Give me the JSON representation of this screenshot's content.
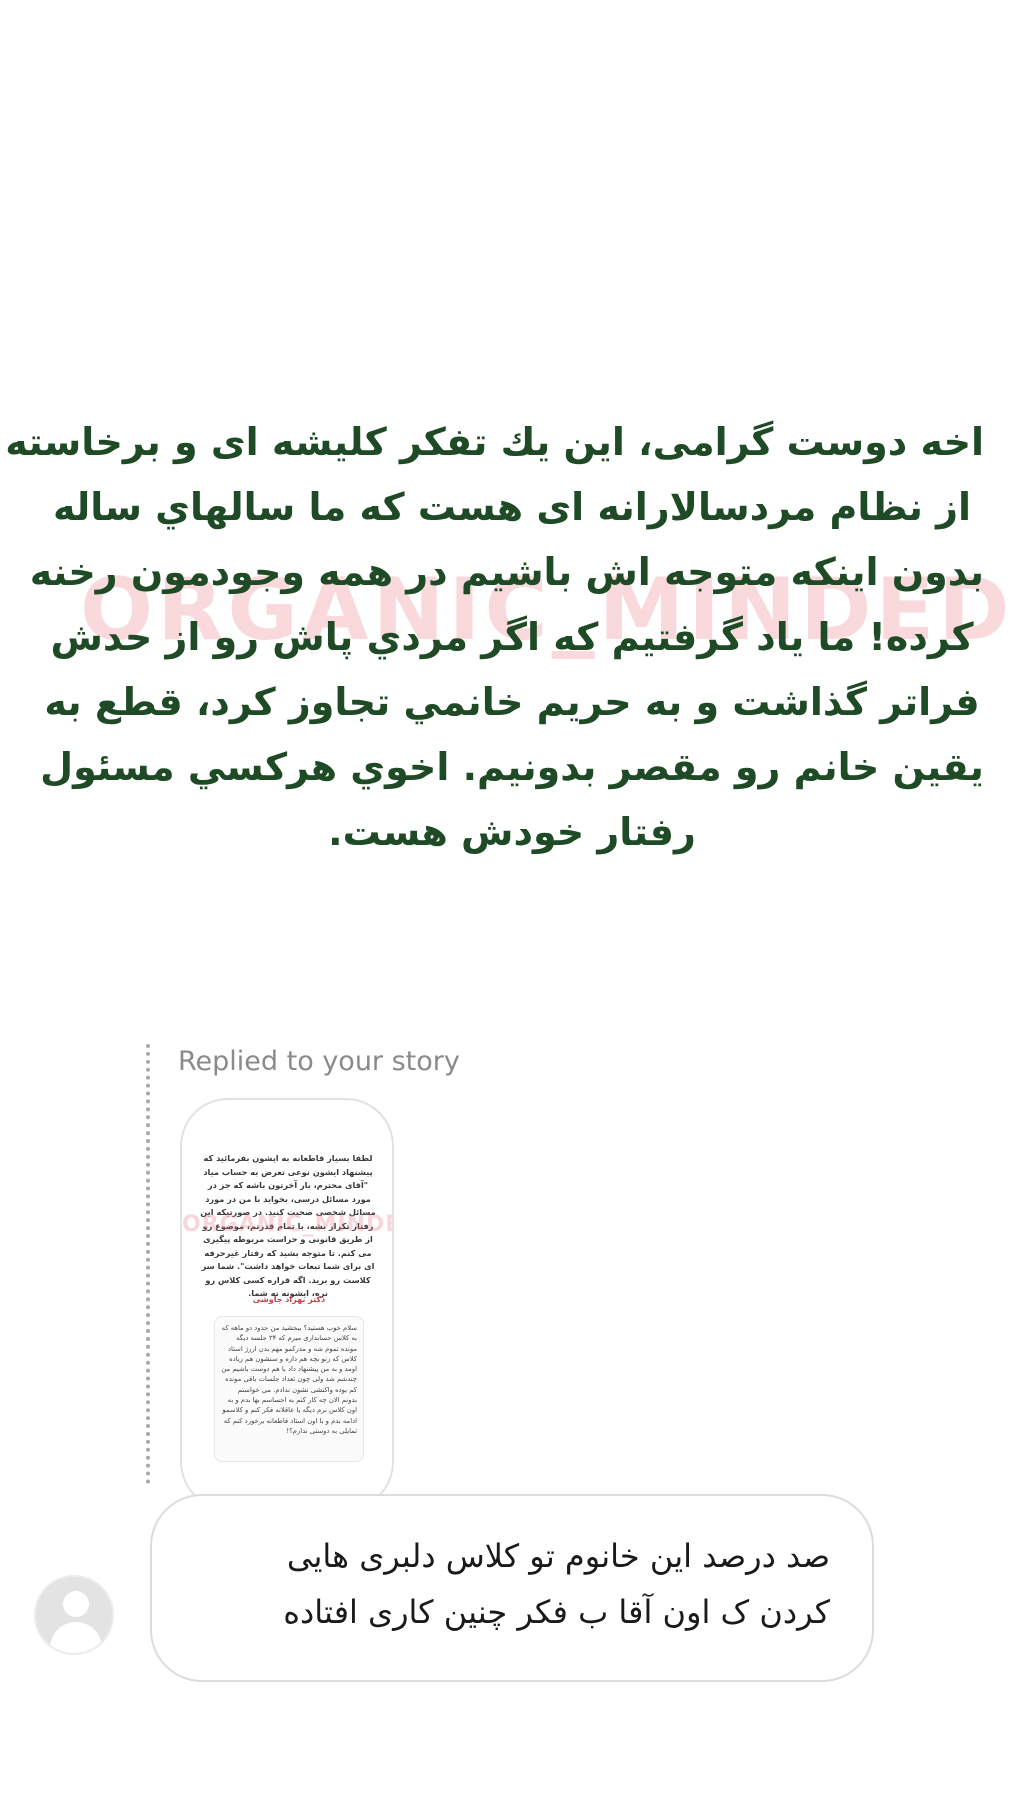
{
  "post": {
    "watermark": "ORGANIC_MINDED",
    "lines": [
      "اخه دوست گرامی، این یك تفکر کلیشه ای و برخاسته",
      "از نظام مردسالارانه ای هست که ما سالهاي ساله",
      "بدون اینکه متوجه اش باشیم در همه وجودمون رخنه",
      "کرده!  ما یاد گرفتیم که اگر مردي پاش رو از حدش",
      "فراتر گذاشت و به حریم خانمي تجاوز کرد، قطع به",
      "یقین خانم رو مقصر بدونیم. اخوي هرکسي مسئول",
      "رفتار خودش هست."
    ],
    "text_color": "#1f4a26"
  },
  "reply": {
    "label": "Replied to your story",
    "story_thumbnail": {
      "watermark": "ORGANIC_MINDED",
      "text": "لطفا بسیار قاطعانه به ایشون بفرمائید که پیشنهاد ایشون نوعی تعرض به حساب میاد \"آقای محترم، بار آخرتون باشه که جز در مورد مسائل درسی، بخواید با من در مورد مسائل شخصی صحبت کنید. در صورتیکه این رفتار تکرار بشه، با تمام قدرتم، موضوع رو از طریق قانونی و حراست مربوطه پیگیری می کنم. تا متوجه بشید که رفتار غیرحرفه ای برای شما تبعات خواهد داشت\". شما سر کلاست رو برید. اگه قراره کسی کلاس رو نره، ایشونه نه شما.",
      "signature": "دکتر بهزاد جاوشی",
      "card_text": "سلام خوب هستید؟ ببخشید من حدود دو ماهه که به کلاس حسابداری میرم که ۳۴ جلسه دیگه مونده تموم شه و مدرکمو مهم بدن اررژ استاد کلاس که زنو بچه هم داره و سنشون هم زیاده اومد و به من پیشنهاد داد با هم دوست باشیم من چندشم شد ولی چون تعداد جلسات باقی مونده کم بوده واکنشی نشون ندادم. می خواستم بدونم الان چه کار کنم به احساسم بها بدم و به اون کلاس نرم دیگه یا عاقلانه فکر کنم و کلاسمو ادامه بدم و با اون استاد قاطعانه برخورد کنم که تمایلی به دوستی ندارم؟!"
    },
    "message_lines": [
      "صد درصد این خانوم تو کلاس دلبری هایی",
      "کردن ک اون آقا ب فکر چنین کاری افتاده"
    ]
  }
}
